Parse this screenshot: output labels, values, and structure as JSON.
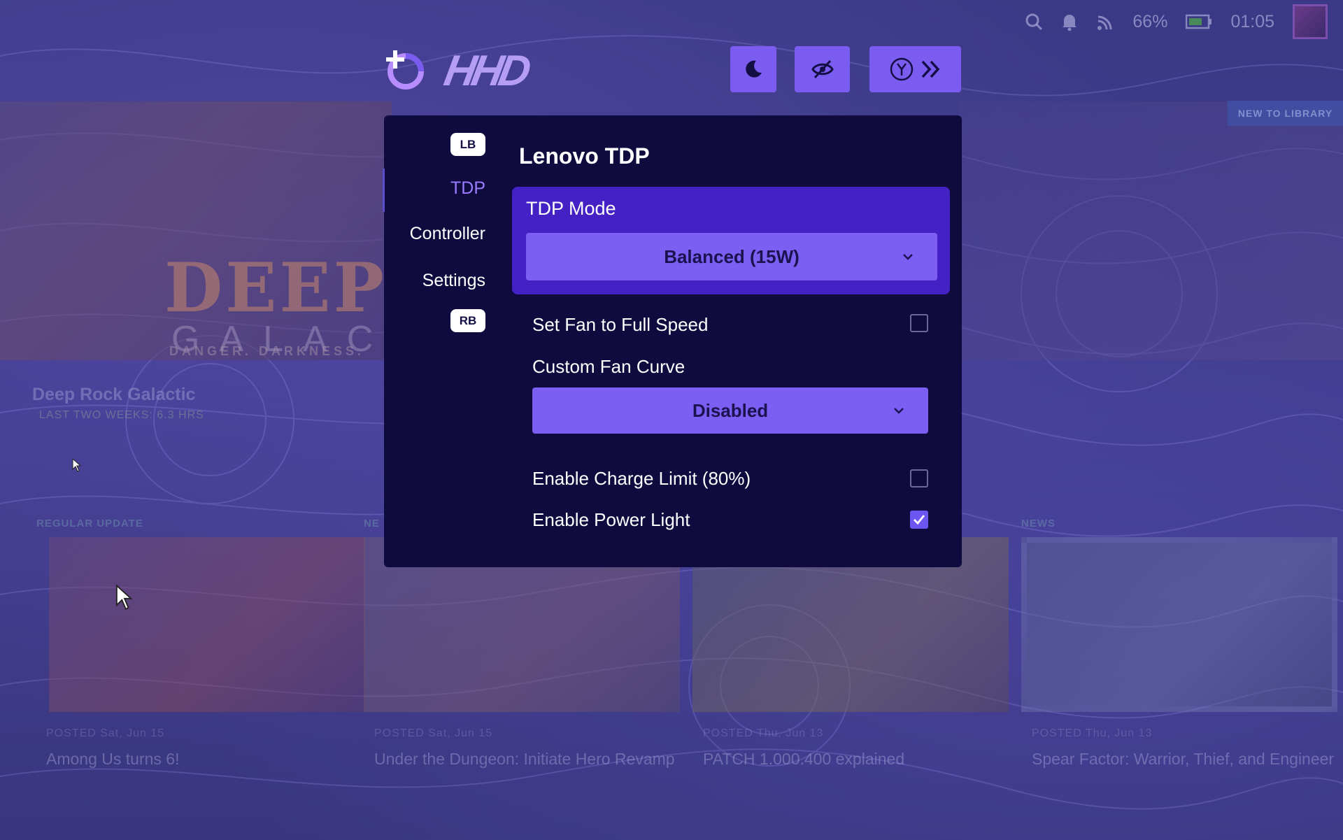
{
  "status": {
    "battery_percent": "66%",
    "time": "01:05"
  },
  "background": {
    "hero_logo": "DEEP RI",
    "hero_sub": "GALACT",
    "hero_tag": "DANGER. DARKNESS.",
    "game_title": "Deep Rock Galactic",
    "game_sub": "LAST TWO WEEKS: 6.3 HRS",
    "new_badge": "NEW TO LIBRARY",
    "sections": [
      "REGULAR UPDATE",
      "NE",
      "",
      "NEWS"
    ],
    "news": [
      {
        "meta": "POSTED Sat, Jun 15",
        "title": "Among Us turns 6!"
      },
      {
        "meta": "POSTED Sat, Jun 15",
        "title": "Under the Dungeon: Initiate Hero Revamp"
      },
      {
        "meta": "POSTED Thu, Jun 13",
        "title": "PATCH 1.000.400 explained"
      },
      {
        "meta": "POSTED Thu, Jun 13",
        "title": "Spear Factor: Warrior, Thief, and Engineer"
      }
    ]
  },
  "header": {
    "logo_text": "HHD"
  },
  "nav": {
    "lb": "LB",
    "rb": "RB",
    "items": [
      "TDP",
      "Controller",
      "Settings"
    ]
  },
  "panel": {
    "title": "Lenovo TDP",
    "tdp_mode_label": "TDP Mode",
    "tdp_mode_value": "Balanced (15W)",
    "fan_full_speed_label": "Set Fan to Full Speed",
    "fan_full_speed_checked": false,
    "fan_curve_label": "Custom Fan Curve",
    "fan_curve_value": "Disabled",
    "charge_limit_label": "Enable Charge Limit (80%)",
    "charge_limit_checked": false,
    "power_light_label": "Enable Power Light",
    "power_light_checked": true
  },
  "colors": {
    "accent": "#7b5ff2",
    "panel_bg": "#100b3f",
    "tdp_box": "#4421c4",
    "active_nav": "#9a7cff"
  }
}
